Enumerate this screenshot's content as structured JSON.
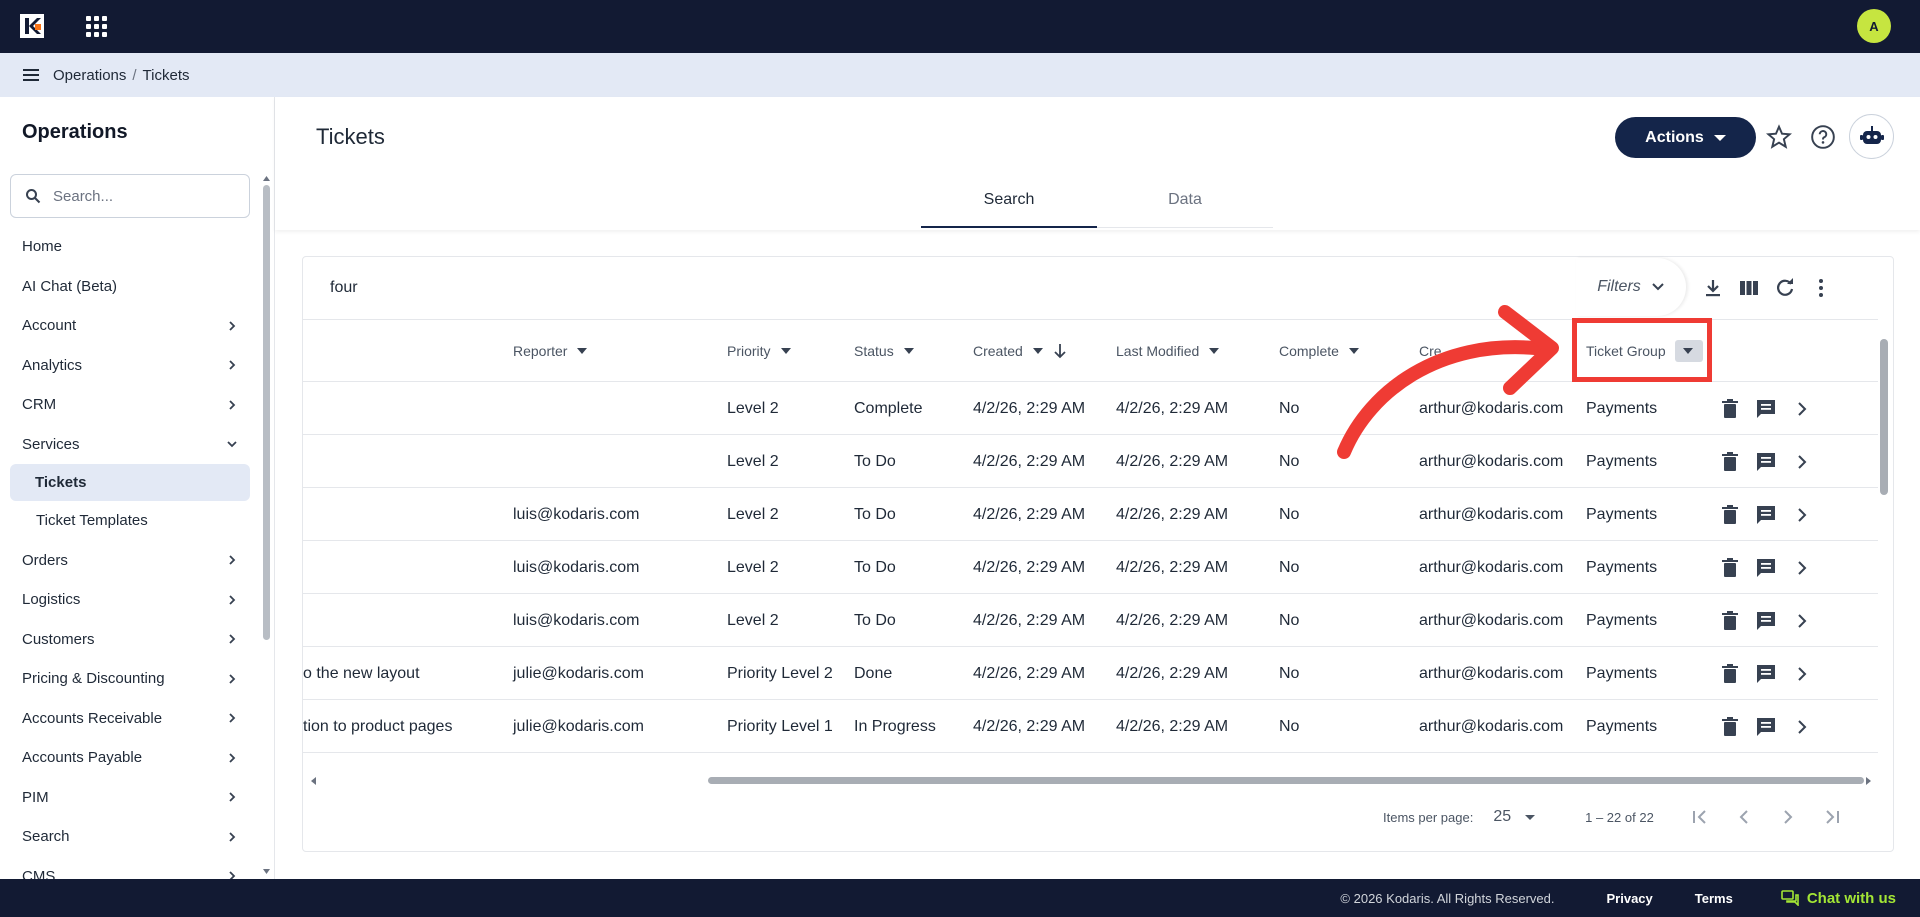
{
  "topbar": {
    "avatar_initial": "A",
    "logo_icon": "kodaris-logo-icon",
    "apps_icon": "apps-grid-icon"
  },
  "breadcrumb": {
    "items": [
      "Operations",
      "Tickets"
    ],
    "separator": "/"
  },
  "sidebar": {
    "title": "Operations",
    "search_placeholder": "Search...",
    "items": [
      {
        "label": "Home",
        "chevron": false
      },
      {
        "label": "AI Chat (Beta)",
        "chevron": false
      },
      {
        "label": "Account",
        "chevron": true
      },
      {
        "label": "Analytics",
        "chevron": true
      },
      {
        "label": "CRM",
        "chevron": true
      },
      {
        "label": "Services",
        "chevron": true,
        "expanded": true
      },
      {
        "label": "Tickets",
        "child": true,
        "active": true
      },
      {
        "label": "Ticket Templates",
        "child": true
      },
      {
        "label": "Orders",
        "chevron": true
      },
      {
        "label": "Logistics",
        "chevron": true
      },
      {
        "label": "Customers",
        "chevron": true
      },
      {
        "label": "Pricing & Discounting",
        "chevron": true
      },
      {
        "label": "Accounts Receivable",
        "chevron": true
      },
      {
        "label": "Accounts Payable",
        "chevron": true
      },
      {
        "label": "PIM",
        "chevron": true
      },
      {
        "label": "Search",
        "chevron": true
      },
      {
        "label": "CMS",
        "chevron": true
      }
    ]
  },
  "header": {
    "title": "Tickets",
    "actions_label": "Actions",
    "tabs": [
      "Search",
      "Data"
    ],
    "active_tab": "Search"
  },
  "search": {
    "query": "four",
    "filters_label": "Filters"
  },
  "table": {
    "columns": [
      "Reporter",
      "Priority",
      "Status",
      "Created",
      "Last Modified",
      "Complete",
      "Cre",
      "Ticket Group"
    ],
    "rows": [
      {
        "title": "",
        "reporter": "",
        "priority": "Level 2",
        "status": "Complete",
        "created": "4/2/26, 2:29 AM",
        "modified": "4/2/26, 2:29 AM",
        "complete": "No",
        "creator": "arthur@kodaris.com",
        "group": "Payments"
      },
      {
        "title": "",
        "reporter": "",
        "priority": "Level 2",
        "status": "To Do",
        "created": "4/2/26, 2:29 AM",
        "modified": "4/2/26, 2:29 AM",
        "complete": "No",
        "creator": "arthur@kodaris.com",
        "group": "Payments"
      },
      {
        "title": "",
        "reporter": "luis@kodaris.com",
        "priority": "Level 2",
        "status": "To Do",
        "created": "4/2/26, 2:29 AM",
        "modified": "4/2/26, 2:29 AM",
        "complete": "No",
        "creator": "arthur@kodaris.com",
        "group": "Payments"
      },
      {
        "title": "",
        "reporter": "luis@kodaris.com",
        "priority": "Level 2",
        "status": "To Do",
        "created": "4/2/26, 2:29 AM",
        "modified": "4/2/26, 2:29 AM",
        "complete": "No",
        "creator": "arthur@kodaris.com",
        "group": "Payments"
      },
      {
        "title": "",
        "reporter": "luis@kodaris.com",
        "priority": "Level 2",
        "status": "To Do",
        "created": "4/2/26, 2:29 AM",
        "modified": "4/2/26, 2:29 AM",
        "complete": "No",
        "creator": "arthur@kodaris.com",
        "group": "Payments"
      },
      {
        "title": "o the new layout",
        "reporter": "julie@kodaris.com",
        "priority": "Priority Level 2",
        "status": "Done",
        "created": "4/2/26, 2:29 AM",
        "modified": "4/2/26, 2:29 AM",
        "complete": "No",
        "creator": "arthur@kodaris.com",
        "group": "Payments"
      },
      {
        "title": "tion to product pages",
        "reporter": "julie@kodaris.com",
        "priority": "Priority Level 1",
        "status": "In Progress",
        "created": "4/2/26, 2:29 AM",
        "modified": "4/2/26, 2:29 AM",
        "complete": "No",
        "creator": "arthur@kodaris.com",
        "group": "Payments"
      }
    ]
  },
  "pagination": {
    "items_per_page_label": "Items per page:",
    "items_per_page": "25",
    "range": "1 – 22 of 22"
  },
  "footer": {
    "copyright": "© 2026 Kodaris. All Rights Reserved.",
    "privacy": "Privacy",
    "terms": "Terms",
    "chat": "Chat with us"
  },
  "annotation": {
    "color": "#ef3b34",
    "target": "Ticket Group"
  }
}
